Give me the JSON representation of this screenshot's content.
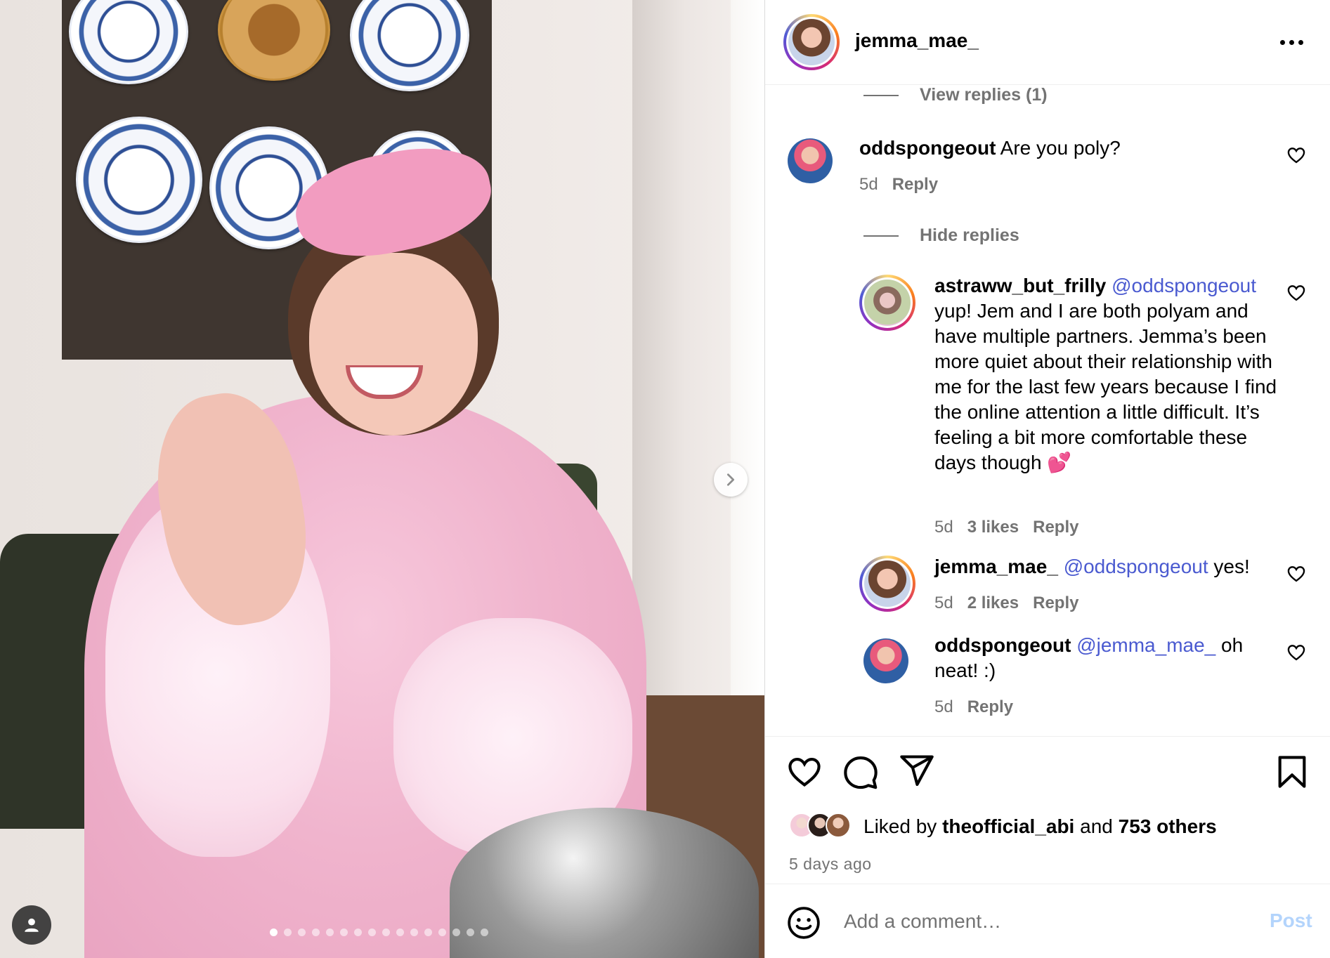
{
  "post": {
    "author": "jemma_mae_",
    "photo_alt": "jemma_mae_ post photo",
    "carousel": {
      "total": 16,
      "active_index": 0
    }
  },
  "comments_panel": {
    "view_replies": "View replies (1)",
    "hide_replies": "Hide replies",
    "comments": [
      {
        "user": "oddspongeout",
        "text": "Are you poly?",
        "time": "5d",
        "reply": "Reply"
      }
    ],
    "replies": [
      {
        "user": "astraww_but_frilly",
        "mention": "@oddspongeout",
        "text": "yup! Jem and I are both polyam and have multiple partners. Jemma’s been more quiet about their relationship with me for the last few years because I find the online attention a little difficult. It’s feeling a bit more comfortable these days though 💕",
        "time": "5d",
        "likes": "3 likes",
        "reply": "Reply"
      },
      {
        "user": "jemma_mae_",
        "mention": "@oddspongeout",
        "text": "yes!",
        "time": "5d",
        "likes": "2 likes",
        "reply": "Reply"
      },
      {
        "user": "oddspongeout",
        "mention": "@jemma_mae_",
        "text": "oh neat! :)",
        "time": "5d",
        "reply": "Reply"
      }
    ]
  },
  "actions": {
    "liked_by_prefix": "Liked by ",
    "liked_by_user": "theofficial_abi",
    "liked_by_and": " and ",
    "liked_by_others": "753 others",
    "time_ago": "5 days ago"
  },
  "add_comment": {
    "placeholder": "Add a comment…",
    "post_label": "Post"
  },
  "icons": {
    "more": "more-horizontal-icon",
    "like": "heart-icon",
    "comment": "comment-bubble-icon",
    "share": "paper-plane-icon",
    "save": "bookmark-icon",
    "emoji": "smiley-icon",
    "next": "chevron-right-icon",
    "tags": "user-tag-icon"
  },
  "colors": {
    "link": "#4a5ad0",
    "muted": "#737373",
    "post_disabled": "#b3d4fc"
  }
}
